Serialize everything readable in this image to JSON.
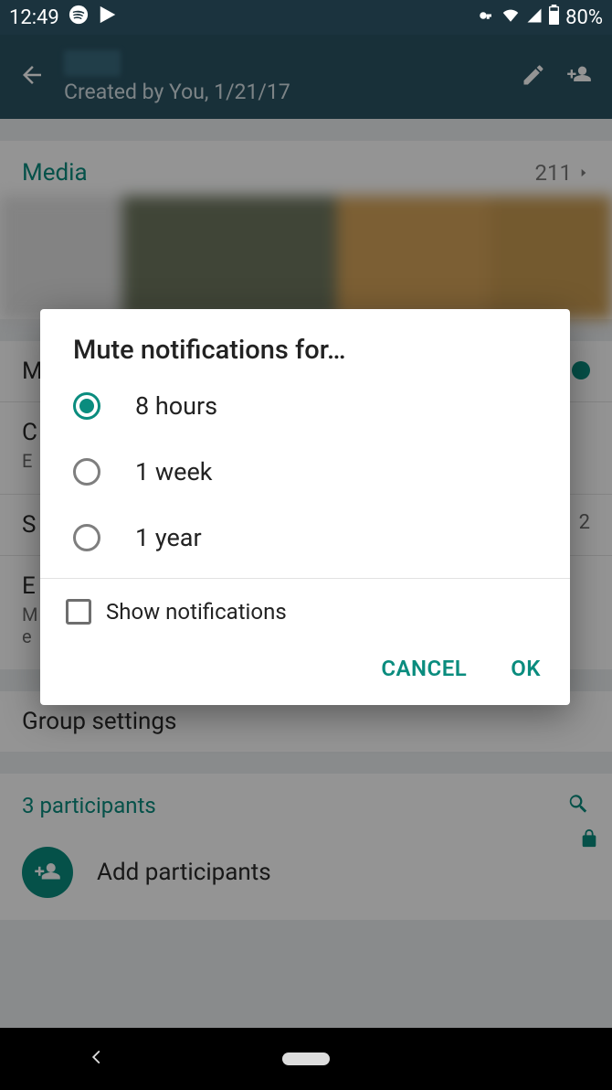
{
  "status": {
    "time": "12:49",
    "battery": "80%"
  },
  "appbar": {
    "subtitle": "Created by You, 1/21/17"
  },
  "media": {
    "label": "Media",
    "count": "211"
  },
  "rows": {
    "mute": "M",
    "custom": "C",
    "custom_sub": "E",
    "starred": "S",
    "starred_count": "2",
    "encryption": "E",
    "encryption_sub": "M\ne",
    "groupsettings": "Group settings"
  },
  "participants": {
    "count_label": "3 participants",
    "add": "Add participants"
  },
  "dialog": {
    "title": "Mute notifications for…",
    "options": [
      "8 hours",
      "1 week",
      "1 year"
    ],
    "selected": 0,
    "checkbox_label": "Show notifications",
    "cancel": "CANCEL",
    "ok": "OK"
  },
  "colors": {
    "accent": "#0a8c7e",
    "appbar": "#2a5363",
    "statusbar": "#1b333e"
  }
}
